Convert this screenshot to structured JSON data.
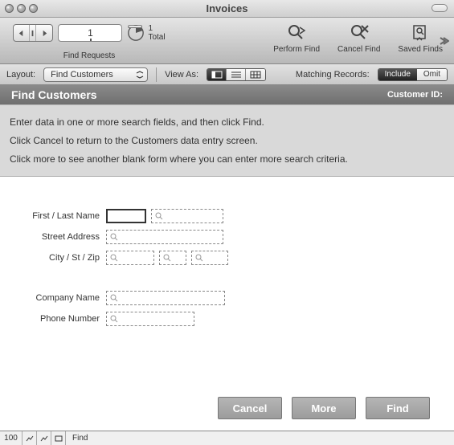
{
  "window": {
    "title": "Invoices"
  },
  "toolbar": {
    "record_number": "1",
    "total_count": "1",
    "total_label": "Total",
    "find_requests_label": "Find Requests",
    "perform_find": "Perform Find",
    "cancel_find": "Cancel Find",
    "saved_finds": "Saved Finds"
  },
  "formatbar": {
    "layout_label": "Layout:",
    "layout_value": "Find Customers",
    "viewas_label": "View As:",
    "matching_label": "Matching Records:",
    "include": "Include",
    "omit": "Omit"
  },
  "header": {
    "title": "Find Customers",
    "customer_id_label": "Customer ID:"
  },
  "instructions": {
    "line1": "Enter data in one or more search fields, and then click Find.",
    "line2": "Click Cancel to return to the Customers data entry screen.",
    "line3": "Click more to see another blank form where you can enter more search criteria."
  },
  "form": {
    "first_last": "First / Last Name",
    "street": "Street Address",
    "city_st_zip": "City / St / Zip",
    "company": "Company Name",
    "phone": "Phone Number"
  },
  "actions": {
    "cancel": "Cancel",
    "more": "More",
    "find": "Find"
  },
  "status": {
    "zoom": "100",
    "mode": "Find"
  }
}
